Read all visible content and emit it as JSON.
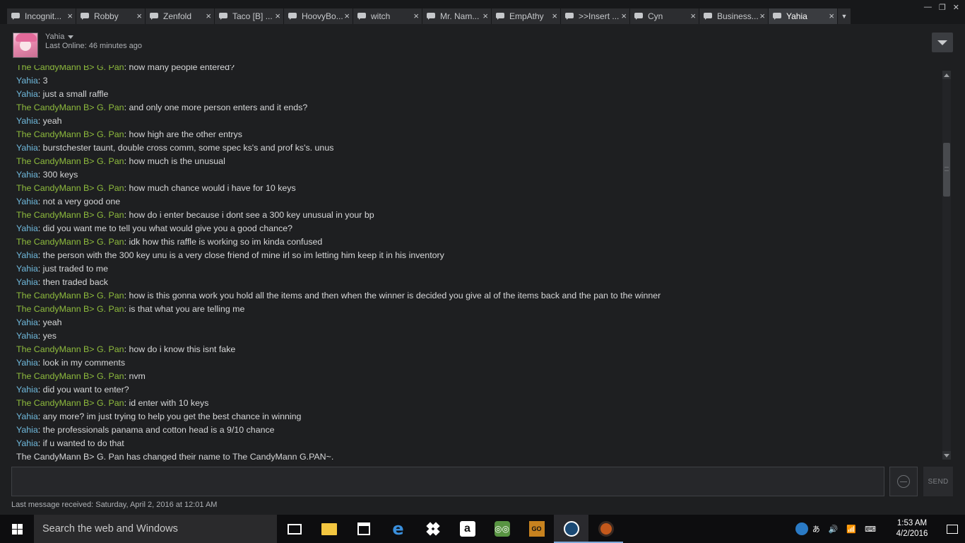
{
  "tabs": [
    {
      "label": "Incognit..."
    },
    {
      "label": "Robby"
    },
    {
      "label": "Zenfold"
    },
    {
      "label": "Taco [B] ..."
    },
    {
      "label": "HoovyBo..."
    },
    {
      "label": "witch"
    },
    {
      "label": "Mr. Nam..."
    },
    {
      "label": "EmpAthy"
    },
    {
      "label": ">>Insert ..."
    },
    {
      "label": "Cyn"
    },
    {
      "label": "Business..."
    },
    {
      "label": "Yahia"
    }
  ],
  "tab_close": "×",
  "window_buttons": {
    "minimize": "—",
    "maximize": "❐",
    "close": "✕"
  },
  "header": {
    "friend_name": "Yahia",
    "last_online": "Last Online: 46 minutes ago"
  },
  "messages": [
    {
      "speaker": "The CandyMann B> G. Pan",
      "role": "other",
      "text": "how many people entered?"
    },
    {
      "speaker": "Yahia",
      "role": "self",
      "text": "3"
    },
    {
      "speaker": "Yahia",
      "role": "self",
      "text": "just a small raffle"
    },
    {
      "speaker": "The CandyMann B> G. Pan",
      "role": "other",
      "text": "and only one more person enters and it ends?"
    },
    {
      "speaker": "Yahia",
      "role": "self",
      "text": "yeah"
    },
    {
      "speaker": "The CandyMann B> G. Pan",
      "role": "other",
      "text": "how high are the other entrys"
    },
    {
      "speaker": "Yahia",
      "role": "self",
      "text": "burstchester taunt, double cross comm, some spec ks's and prof ks's. unus"
    },
    {
      "speaker": "The CandyMann B> G. Pan",
      "role": "other",
      "text": "how much is the unusual"
    },
    {
      "speaker": "Yahia",
      "role": "self",
      "text": "300 keys"
    },
    {
      "speaker": "The CandyMann B> G. Pan",
      "role": "other",
      "text": "how much chance would i have for 10 keys"
    },
    {
      "speaker": "Yahia",
      "role": "self",
      "text": "not a very good one"
    },
    {
      "speaker": "The CandyMann B> G. Pan",
      "role": "other",
      "text": "how do i enter because i dont see a 300 key unusual in your bp"
    },
    {
      "speaker": "Yahia",
      "role": "self",
      "text": "did you want me to tell you what would give you a good chance?"
    },
    {
      "speaker": "The CandyMann B> G. Pan",
      "role": "other",
      "text": "idk how this raffle is working so im kinda confused"
    },
    {
      "speaker": "Yahia",
      "role": "self",
      "text": "the person with the 300 key unu is a very close friend of mine irl so im letting him keep it in his inventory"
    },
    {
      "speaker": "Yahia",
      "role": "self",
      "text": "just traded to me"
    },
    {
      "speaker": "Yahia",
      "role": "self",
      "text": "then traded back"
    },
    {
      "speaker": "The CandyMann B> G. Pan",
      "role": "other",
      "text": "how is this gonna work you hold all the items and then when the winner is decided you give al of the items back and the pan to the winner"
    },
    {
      "speaker": "The CandyMann B> G. Pan",
      "role": "other",
      "text": "is that what you are telling me"
    },
    {
      "speaker": "Yahia",
      "role": "self",
      "text": "yeah"
    },
    {
      "speaker": "Yahia",
      "role": "self",
      "text": "yes"
    },
    {
      "speaker": "The CandyMann B> G. Pan",
      "role": "other",
      "text": "how do i know this isnt fake"
    },
    {
      "speaker": "Yahia",
      "role": "self",
      "text": "look in my comments"
    },
    {
      "speaker": "The CandyMann B> G. Pan",
      "role": "other",
      "text": "nvm"
    },
    {
      "speaker": "Yahia",
      "role": "self",
      "text": "did you want to enter?"
    },
    {
      "speaker": "The CandyMann B> G. Pan",
      "role": "other",
      "text": "id enter with 10 keys"
    },
    {
      "speaker": "Yahia",
      "role": "self",
      "text": "any more? im just trying to help you get the best chance in winning"
    },
    {
      "speaker": "Yahia",
      "role": "self",
      "text": "the professionals panama and cotton head is a 9/10 chance"
    },
    {
      "speaker": "Yahia",
      "role": "self",
      "text": "if u wanted to do that"
    }
  ],
  "system_message": "The CandyMann B> G. Pan has changed their name to The CandyMann G.PAN~.",
  "input": {
    "value": "",
    "placeholder": ""
  },
  "send_label": "SEND",
  "last_message_received": "Last message received: Saturday, April 2, 2016 at 12:01 AM",
  "taskbar": {
    "search_placeholder": "Search the web and Windows",
    "amazon_glyph": "a",
    "trip_glyph": "◎◎",
    "csgo_glyph": "GO",
    "edge_glyph": "e",
    "tray_ime": "あ",
    "tray_volume": "🔊",
    "tray_network": "📶",
    "tray_keyboard": "⌨",
    "time": "1:53 AM",
    "date": "4/2/2016"
  },
  "colors": {
    "self_speaker": "#6fb8db",
    "other_speaker": "#8fbc3d",
    "background": "#1e1f21"
  }
}
